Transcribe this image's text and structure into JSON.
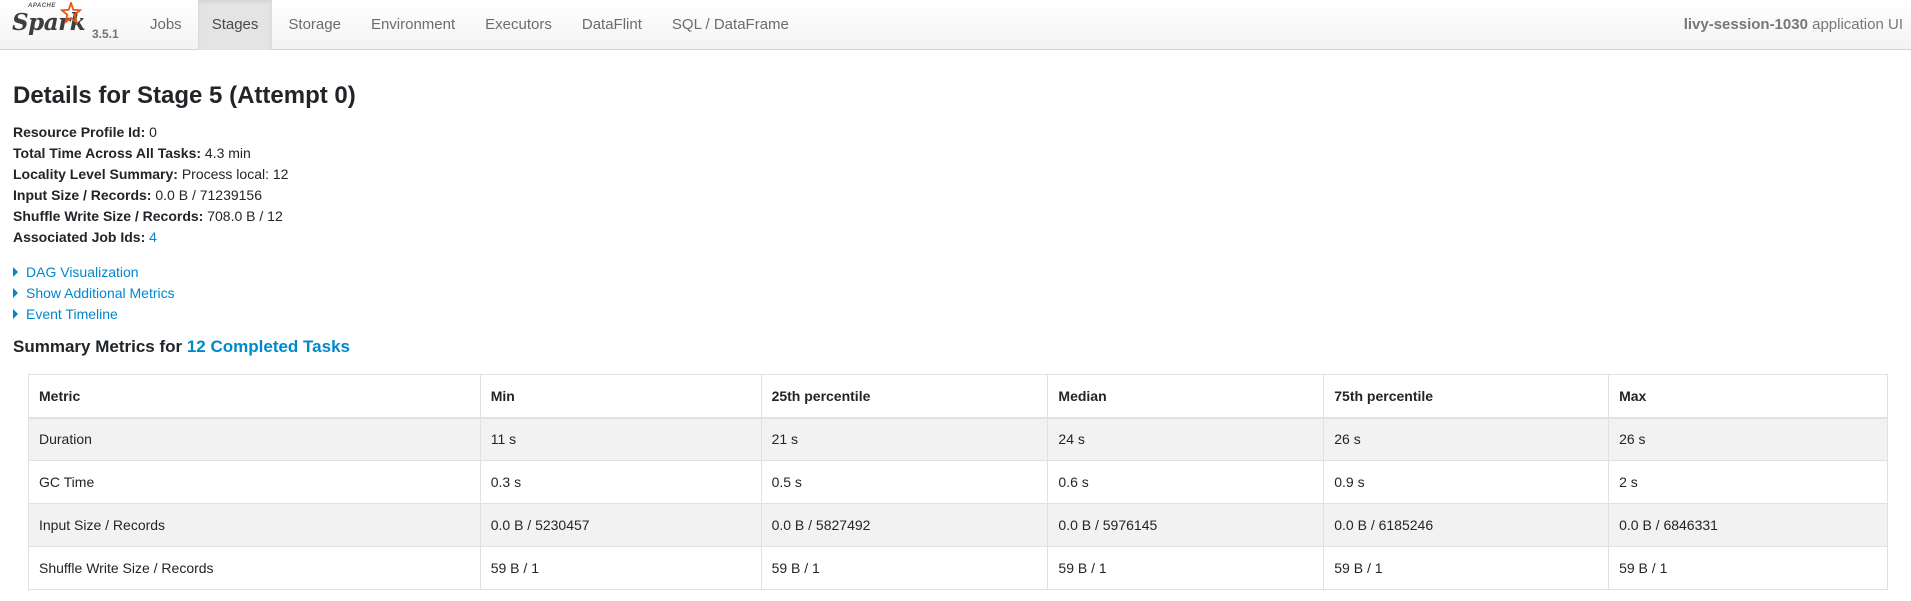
{
  "brand": {
    "apache": "APACHE",
    "name": "Spark",
    "version": "3.5.1"
  },
  "nav": {
    "tabs": [
      {
        "label": "Jobs"
      },
      {
        "label": "Stages"
      },
      {
        "label": "Storage"
      },
      {
        "label": "Environment"
      },
      {
        "label": "Executors"
      },
      {
        "label": "DataFlint"
      },
      {
        "label": "SQL / DataFrame"
      }
    ],
    "active_tab": "Stages",
    "app_name": "livy-session-1030",
    "app_suffix": " application UI"
  },
  "page": {
    "title": "Details for Stage 5 (Attempt 0)",
    "summary": [
      {
        "label": "Resource Profile Id:",
        "value": " 0"
      },
      {
        "label": "Total Time Across All Tasks:",
        "value": " 4.3 min"
      },
      {
        "label": "Locality Level Summary:",
        "value": " Process local: 12"
      },
      {
        "label": "Input Size / Records:",
        "value": " 0.0 B / 71239156"
      },
      {
        "label": "Shuffle Write Size / Records:",
        "value": " 708.0 B / 12"
      },
      {
        "label": "Associated Job Ids:",
        "value": "4"
      }
    ],
    "expanders": [
      {
        "label": "DAG Visualization"
      },
      {
        "label": "Show Additional Metrics"
      },
      {
        "label": "Event Timeline"
      }
    ],
    "section_title": "Summary Metrics for ",
    "section_link": "12 Completed Tasks"
  },
  "metrics_table": {
    "headers": [
      "Metric",
      "Min",
      "25th percentile",
      "Median",
      "75th percentile",
      "Max"
    ],
    "rows": [
      [
        "Duration",
        "11 s",
        "21 s",
        "24 s",
        "26 s",
        "26 s"
      ],
      [
        "GC Time",
        "0.3 s",
        "0.5 s",
        "0.6 s",
        "0.9 s",
        "2 s"
      ],
      [
        "Input Size / Records",
        "0.0 B / 5230457",
        "0.0 B / 5827492",
        "0.0 B / 5976145",
        "0.0 B / 6185246",
        "0.0 B / 6846331"
      ],
      [
        "Shuffle Write Size / Records",
        "59 B / 1",
        "59 B / 1",
        "59 B / 1",
        "59 B / 1",
        "59 B / 1"
      ]
    ]
  },
  "colors": {
    "link": "#0088cc",
    "star": "#e25a1c"
  },
  "icons": {
    "expander": "triangle-right-icon",
    "logo": "spark-star-icon"
  }
}
